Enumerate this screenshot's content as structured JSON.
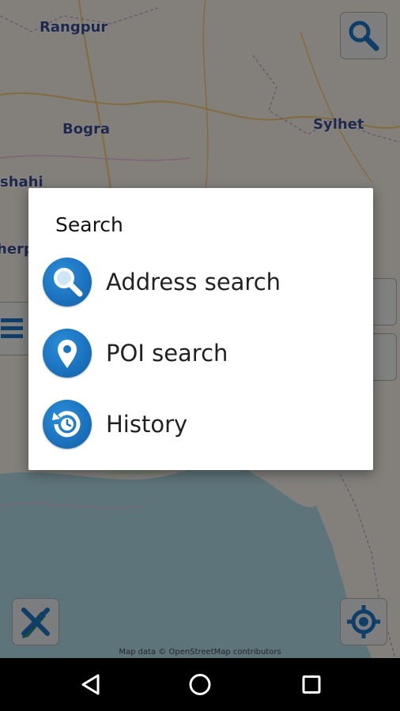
{
  "map": {
    "cities": [
      {
        "name": "Rangpur"
      },
      {
        "name": "Bogra"
      },
      {
        "name": "Sylhet"
      },
      {
        "name": "shahi"
      },
      {
        "name": "herp"
      }
    ],
    "attribution": "Map data © OpenStreetMap contributors"
  },
  "controls": {
    "search_button_icon": "magnifier-icon",
    "clear_button_icon": "pencil-cross-icon",
    "locate_button_icon": "crosshair-icon",
    "list_button_icon": "list-icon"
  },
  "dialog": {
    "title": "Search",
    "items": [
      {
        "label": "Address search",
        "icon": "magnifier-icon"
      },
      {
        "label": "POI search",
        "icon": "map-pin-icon"
      },
      {
        "label": "History",
        "icon": "history-clock-icon"
      }
    ]
  },
  "navbar": {
    "back_icon": "back-triangle-icon",
    "home_icon": "home-circle-icon",
    "recents_icon": "recents-square-icon"
  },
  "colors": {
    "accent_blue": "#1c73c0",
    "city_label": "#3b4a8a",
    "scrim": "rgba(0,0,0,0.45)"
  }
}
